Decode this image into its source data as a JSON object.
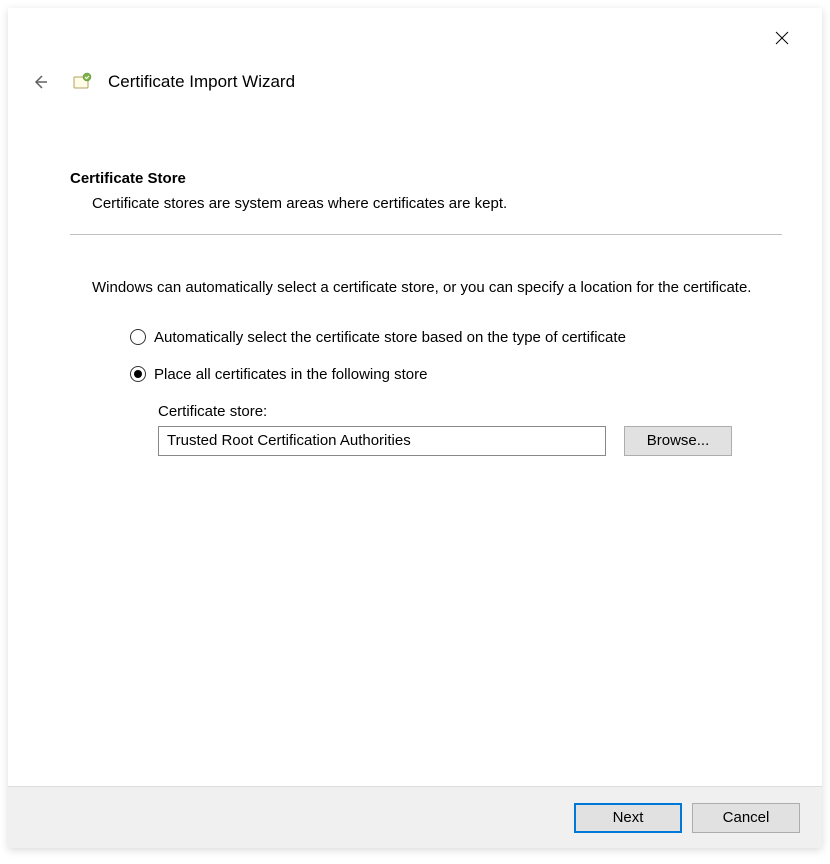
{
  "header": {
    "title": "Certificate Import Wizard"
  },
  "section": {
    "title": "Certificate Store",
    "subtitle": "Certificate stores are system areas where certificates are kept."
  },
  "description": "Windows can automatically select a certificate store, or you can specify a location for the certificate.",
  "radios": {
    "auto": "Automatically select the certificate store based on the type of certificate",
    "manual": "Place all certificates in the following store",
    "selected": "manual"
  },
  "store": {
    "label": "Certificate store:",
    "value": "Trusted Root Certification Authorities",
    "browse": "Browse..."
  },
  "footer": {
    "next": "Next",
    "cancel": "Cancel"
  }
}
